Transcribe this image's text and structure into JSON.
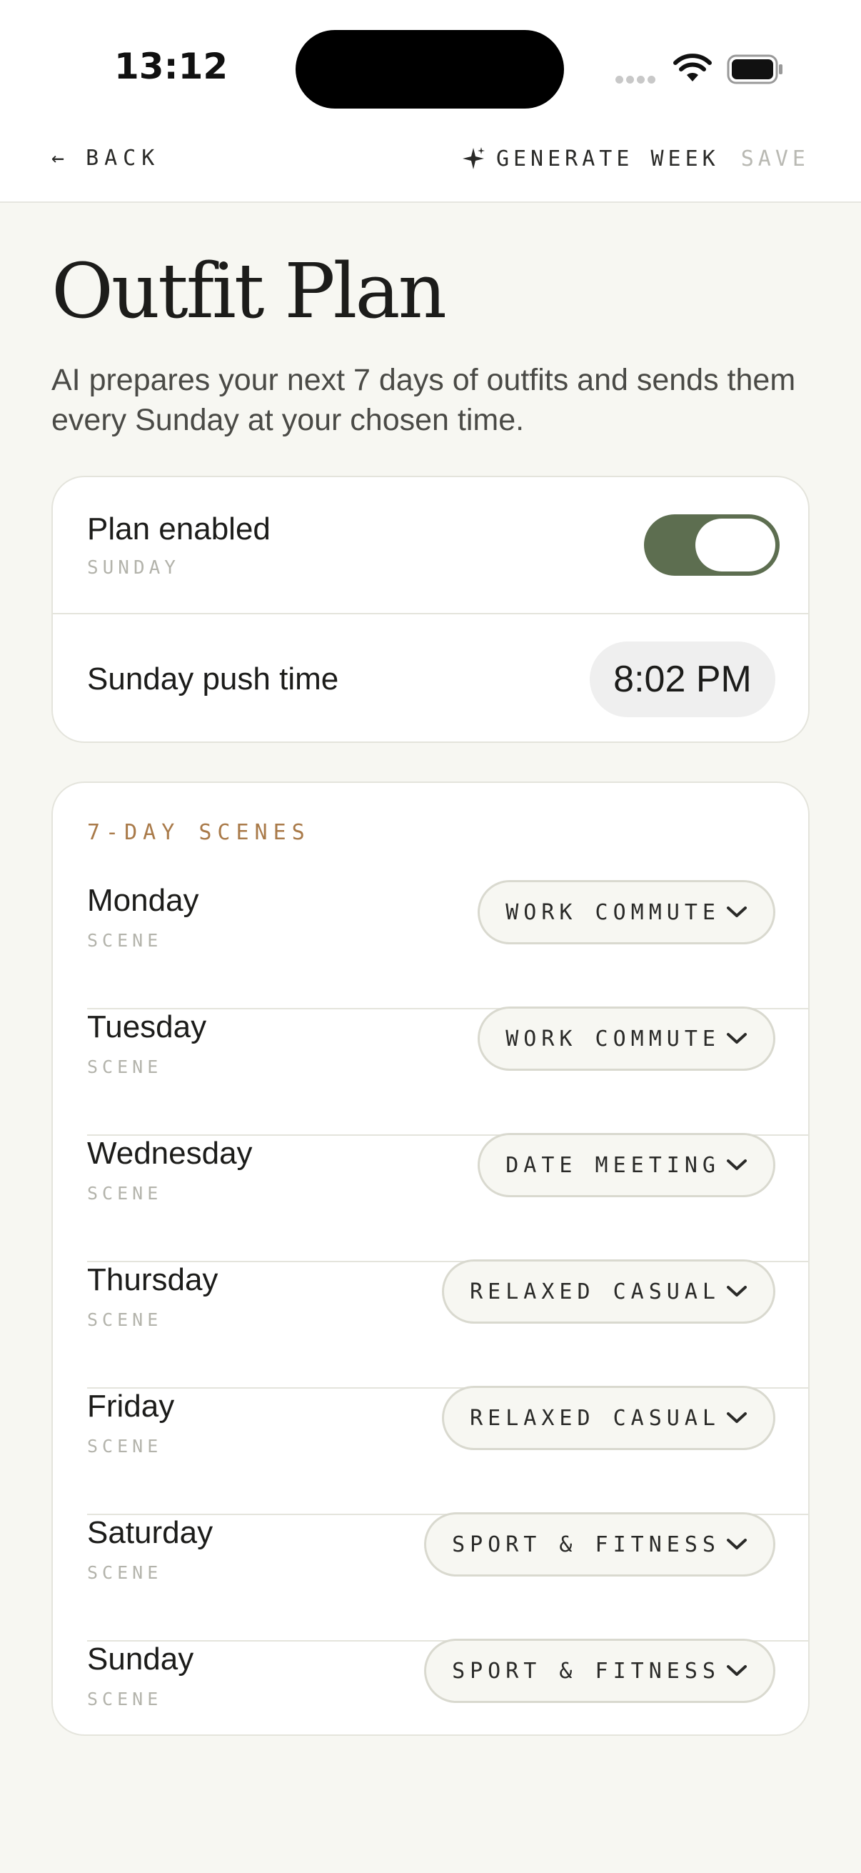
{
  "status_bar": {
    "time": "13:12"
  },
  "nav": {
    "back_label": "BACK",
    "generate_label": "GENERATE WEEK",
    "save_label": "SAVE"
  },
  "page": {
    "title": "Outfit Plan",
    "subtitle": "AI prepares your next 7 days of outfits and sends them every Sunday at your chosen time."
  },
  "plan": {
    "enabled_label": "Plan enabled",
    "enabled_sub": "SUNDAY",
    "enabled": true,
    "push_label": "Sunday push time",
    "push_time": "8:02 PM"
  },
  "scenes": {
    "section_label": "7-DAY SCENES",
    "days": [
      {
        "day": "Monday",
        "sub": "SCENE",
        "scene": "WORK COMMUTE"
      },
      {
        "day": "Tuesday",
        "sub": "SCENE",
        "scene": "WORK COMMUTE"
      },
      {
        "day": "Wednesday",
        "sub": "SCENE",
        "scene": "DATE MEETING"
      },
      {
        "day": "Thursday",
        "sub": "SCENE",
        "scene": "RELAXED CASUAL"
      },
      {
        "day": "Friday",
        "sub": "SCENE",
        "scene": "RELAXED CASUAL"
      },
      {
        "day": "Saturday",
        "sub": "SCENE",
        "scene": "SPORT & FITNESS"
      },
      {
        "day": "Sunday",
        "sub": "SCENE",
        "scene": "SPORT & FITNESS"
      }
    ]
  },
  "colors": {
    "accent_green": "#5d6e50",
    "section_label": "#a97a49",
    "background": "#f7f7f2"
  }
}
